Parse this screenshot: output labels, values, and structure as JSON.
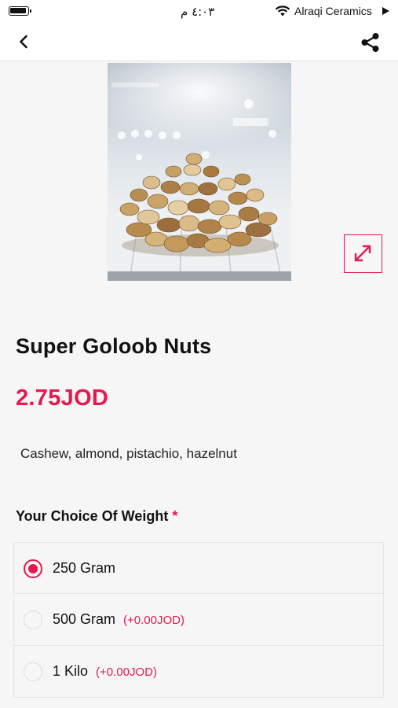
{
  "status_bar": {
    "time": "٤:٠٣ م",
    "carrier": "Alraqi Ceramics"
  },
  "icons": {
    "back": "chevron-left-icon",
    "share": "share-icon",
    "expand": "expand-arrows-icon"
  },
  "product": {
    "title": "Super Goloob Nuts",
    "price": "2.75JOD",
    "description": "Cashew, almond, pistachio, hazelnut"
  },
  "weight_section": {
    "title": "Your Choice Of Weight",
    "required_mark": "*",
    "options": [
      {
        "label": "250 Gram",
        "extra": "",
        "selected": true
      },
      {
        "label": "500 Gram",
        "extra": "(+0.00JOD)",
        "selected": false
      },
      {
        "label": "1 Kilo",
        "extra": "(+0.00JOD)",
        "selected": false
      }
    ]
  },
  "colors": {
    "accent": "#e8174f",
    "background": "#f6f6f6"
  }
}
